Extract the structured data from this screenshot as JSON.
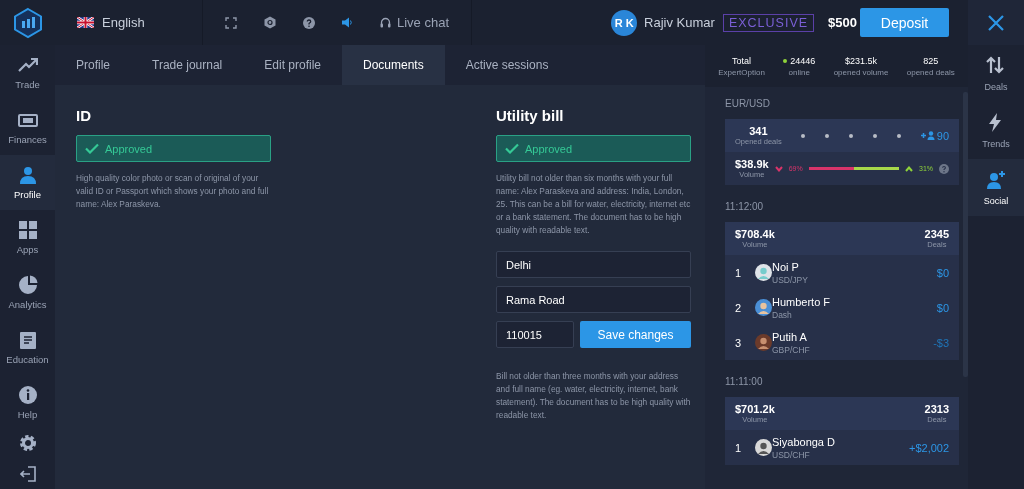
{
  "top_bar": {
    "language": "English",
    "live_chat": "Live chat",
    "user": {
      "initials": "R K",
      "name": "Rajiv Kumar"
    },
    "badge": "EXCLUSIVE",
    "balance": "$500",
    "deposit_button": "Deposit"
  },
  "left_nav": [
    {
      "label": "Trade",
      "selected": false
    },
    {
      "label": "Finances",
      "selected": false
    },
    {
      "label": "Profile",
      "selected": true
    },
    {
      "label": "Apps",
      "selected": false
    },
    {
      "label": "Analytics",
      "selected": false
    },
    {
      "label": "Education",
      "selected": false
    },
    {
      "label": "Help",
      "selected": false
    }
  ],
  "tabs": [
    {
      "label": "Profile",
      "selected": false
    },
    {
      "label": "Trade journal",
      "selected": false
    },
    {
      "label": "Edit profile",
      "selected": false
    },
    {
      "label": "Documents",
      "selected": true
    },
    {
      "label": "Active sessions",
      "selected": false
    }
  ],
  "documents": [
    {
      "title": "ID",
      "status": "Approved",
      "approved": true,
      "description": "High quality color photo or scan of original of your valid ID or Passport which shows your photo and full name: Alex Paraskeva."
    },
    {
      "title": "Utility bill",
      "status": "Approved",
      "approved": true,
      "description": "Utility bill not older than six months with your full name: Alex Paraskeva and address: India, London, 25. This can be a bill for water, electricity, internet etc or a bank statement. The document has to be high quality with readable text.",
      "form": {
        "city": "Delhi",
        "street": "Rama Road",
        "postcode": "110015",
        "button": "Save changes",
        "note": "Bill not older than three months with your address and full name (eg. water, electricity, internet, bank statement). The document has to be high quality with readable text."
      }
    }
  ],
  "stats": [
    {
      "value": "Total",
      "label": "ExpertOption",
      "kind": "plain"
    },
    {
      "value": "24446",
      "label": "online",
      "kind": "online"
    },
    {
      "value": "$231.5k",
      "label": "opened volume",
      "kind": "plain"
    },
    {
      "value": "825",
      "label": "opened deals",
      "kind": "plain"
    }
  ],
  "feed": {
    "pair": "EUR/USD",
    "summary": {
      "opened_deals": "341",
      "opened_deals_label": "Opened deals",
      "followers": "90",
      "volume": "$38.9k",
      "volume_label": "Volume",
      "down": "69%",
      "up": "31%",
      "level": 0.5
    },
    "groups": [
      {
        "time": "11:12:00",
        "volume": "$708.4k",
        "volume_label": "Volume",
        "deals": "2345",
        "deals_label": "Deals",
        "traders": [
          {
            "rank": "1",
            "name": "Noi P",
            "asset": "USD/JPY",
            "profit": "$0"
          },
          {
            "rank": "2",
            "name": "Humberto F",
            "asset": "Dash",
            "profit": "$0"
          },
          {
            "rank": "3",
            "name": "Putih A",
            "asset": "GBP/CHF",
            "profit": "-$3"
          }
        ]
      },
      {
        "time": "11:11:00",
        "volume": "$701.2k",
        "volume_label": "Volume",
        "deals": "2313",
        "deals_label": "Deals",
        "traders": [
          {
            "rank": "1",
            "name": "Siyabonga D",
            "asset": "USD/CHF",
            "profit": "+$2,002"
          }
        ]
      }
    ]
  },
  "right_rail": [
    {
      "label": "Deals",
      "selected": false
    },
    {
      "label": "Trends",
      "selected": false
    },
    {
      "label": "Social",
      "selected": true
    }
  ]
}
